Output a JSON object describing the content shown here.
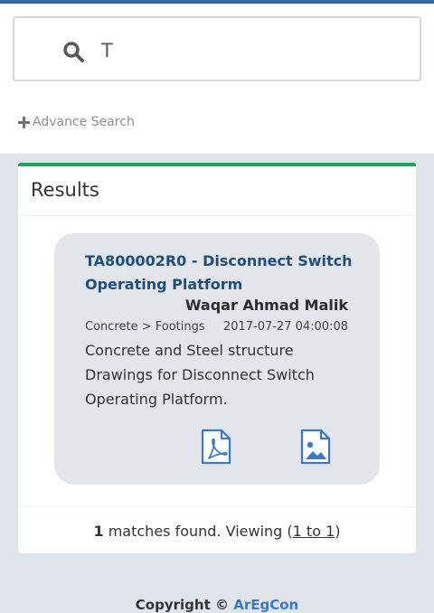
{
  "search": {
    "value": "T",
    "advance_search_label": "Advance Search"
  },
  "results": {
    "title": "Results",
    "items": [
      {
        "title": "TA800002R0 - Disconnect Switch Operating Platform",
        "author": "Waqar Ahmad Malik",
        "category": "Concrete > Footings",
        "date": "2017-07-27 04:00:08",
        "description": "Concrete and Steel structure Drawings for Disconnect Switch Operating Platform.",
        "attachments": [
          {
            "type": "pdf-icon"
          },
          {
            "type": "image-icon"
          }
        ]
      }
    ],
    "footer": {
      "count": "1",
      "text": " matches found. Viewing (",
      "range": "1 to 1",
      "close": ")"
    }
  },
  "footer": {
    "copyright_label": "Copyright ©",
    "brand": "ArEgCon"
  },
  "colors": {
    "accent_green": "#1fa35b",
    "link_blue": "#1f4f7a",
    "top_strip": "#2e6da4"
  }
}
